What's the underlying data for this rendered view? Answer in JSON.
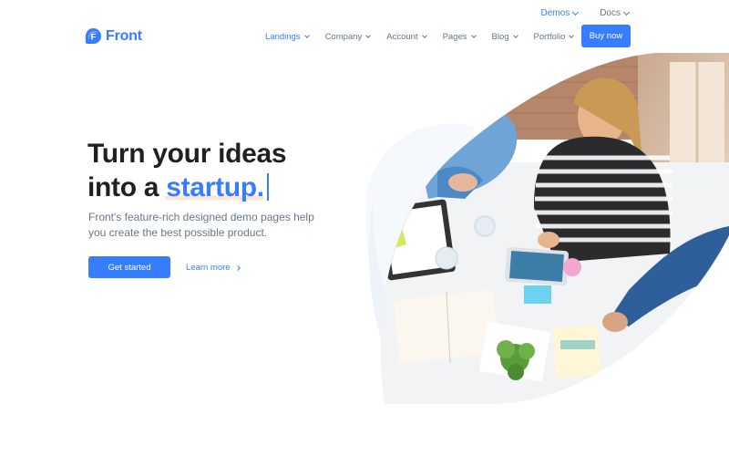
{
  "topbar": {
    "demos_label": "Demos",
    "docs_label": "Docs"
  },
  "header": {
    "brand": "Front",
    "logo_letter": "F",
    "nav": [
      {
        "label": "Landings"
      },
      {
        "label": "Company"
      },
      {
        "label": "Account"
      },
      {
        "label": "Pages"
      },
      {
        "label": "Blog"
      },
      {
        "label": "Portfolio"
      }
    ],
    "buy_label": "Buy now"
  },
  "hero": {
    "title_line1": "Turn your ideas",
    "title_line2_prefix": "into a ",
    "title_highlight": "startup.",
    "subtitle": "Front's feature-rich designed demo pages help you create the best possible product.",
    "primary_cta": "Get started",
    "secondary_cta": "Learn more"
  },
  "colors": {
    "accent": "#377dff",
    "text_dark": "#1e2022",
    "text_muted": "#677788",
    "highlight_underline": "#fde6d3"
  },
  "icons": {
    "logo": "front-logo-icon",
    "dropdown": "chevron-down-icon",
    "arrow": "chevron-right-icon"
  }
}
